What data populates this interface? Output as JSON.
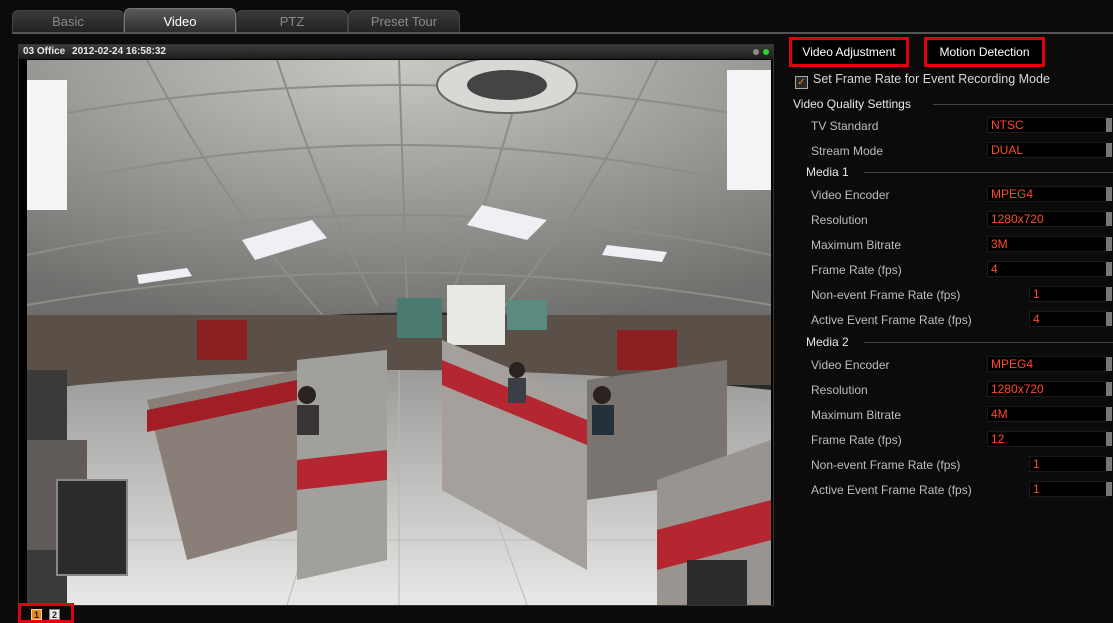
{
  "tabs": [
    "Basic",
    "Video",
    "PTZ",
    "Preset Tour"
  ],
  "active_tab": "Video",
  "video": {
    "camera_label": "03 Office",
    "timestamp": "2012-02-24 16:58:32",
    "status_dot_colors": [
      "#8a8a8a",
      "#2fd22f"
    ]
  },
  "pages": [
    "1",
    "2"
  ],
  "buttons": {
    "video_adjustment": "Video Adjustment",
    "motion_detection": "Motion Detection"
  },
  "event_checkbox": {
    "label": "Set Frame Rate for Event Recording Mode",
    "checked": true
  },
  "quality": {
    "title": "Video Quality Settings",
    "tv_standard_label": "TV Standard",
    "tv_standard": "NTSC",
    "stream_mode_label": "Stream Mode",
    "stream_mode": "DUAL"
  },
  "media1": {
    "title": "Media 1",
    "encoder_label": "Video Encoder",
    "encoder": "MPEG4",
    "resolution_label": "Resolution",
    "resolution": "1280x720",
    "bitrate_label": "Maximum Bitrate",
    "bitrate": "3M",
    "framerate_label": "Frame Rate (fps)",
    "framerate": "4",
    "nonevent_label": "Non-event Frame Rate (fps)",
    "nonevent": "1",
    "active_label": "Active Event Frame Rate (fps)",
    "active": "4"
  },
  "media2": {
    "title": "Media 2",
    "encoder_label": "Video Encoder",
    "encoder": "MPEG4",
    "resolution_label": "Resolution",
    "resolution": "1280x720",
    "bitrate_label": "Maximum Bitrate",
    "bitrate": "4M",
    "framerate_label": "Frame Rate (fps)",
    "framerate": "12",
    "nonevent_label": "Non-event Frame Rate (fps)",
    "nonevent": "1",
    "active_label": "Active Event Frame Rate (fps)",
    "active": "1"
  },
  "colors": {
    "highlight": "#e00010",
    "value_text": "#ff4a2a",
    "check_accent": "#e88b20"
  }
}
